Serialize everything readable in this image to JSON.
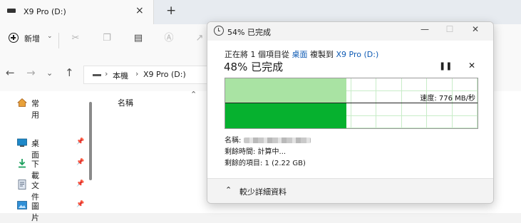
{
  "tab": {
    "title": "X9 Pro (D:)",
    "close_icon": "×",
    "new_tab_icon": "+"
  },
  "toolbar": {
    "new_label": "新增",
    "new_chevron": "⌄"
  },
  "address": {
    "root": "本機",
    "drive": "X9 Pro (D:)",
    "sep": "›"
  },
  "sidebar": {
    "items": [
      {
        "label": "常用",
        "icon": "home-icon"
      },
      {
        "label": "桌面",
        "icon": "desktop-icon",
        "pinned": true
      },
      {
        "label": "下載",
        "icon": "download-icon",
        "pinned": true
      },
      {
        "label": "文件",
        "icon": "document-icon",
        "pinned": true
      },
      {
        "label": "圖片",
        "icon": "pictures-icon",
        "pinned": true
      }
    ]
  },
  "file_list": {
    "column_name": "名稱"
  },
  "dialog": {
    "title": "54% 已完成",
    "from_prefix": "正在將 1 個項目從",
    "from_src": "桌面",
    "from_mid": "複製到",
    "from_dest": "X9 Pro (D:)",
    "percent_text": "48% 已完成",
    "speed_text": "速度: 776 MB/秒",
    "name_label": "名稱:",
    "time_left": "剩餘時間: 計算中...",
    "items_left": "剩餘的項目: 1 (2.22 GB)",
    "less_details": "較少詳細資料",
    "progress_percent": 48,
    "colors": {
      "graph_light": "#a9e3a3",
      "graph_dark": "#06b12f",
      "link": "#0f5bb4"
    }
  }
}
